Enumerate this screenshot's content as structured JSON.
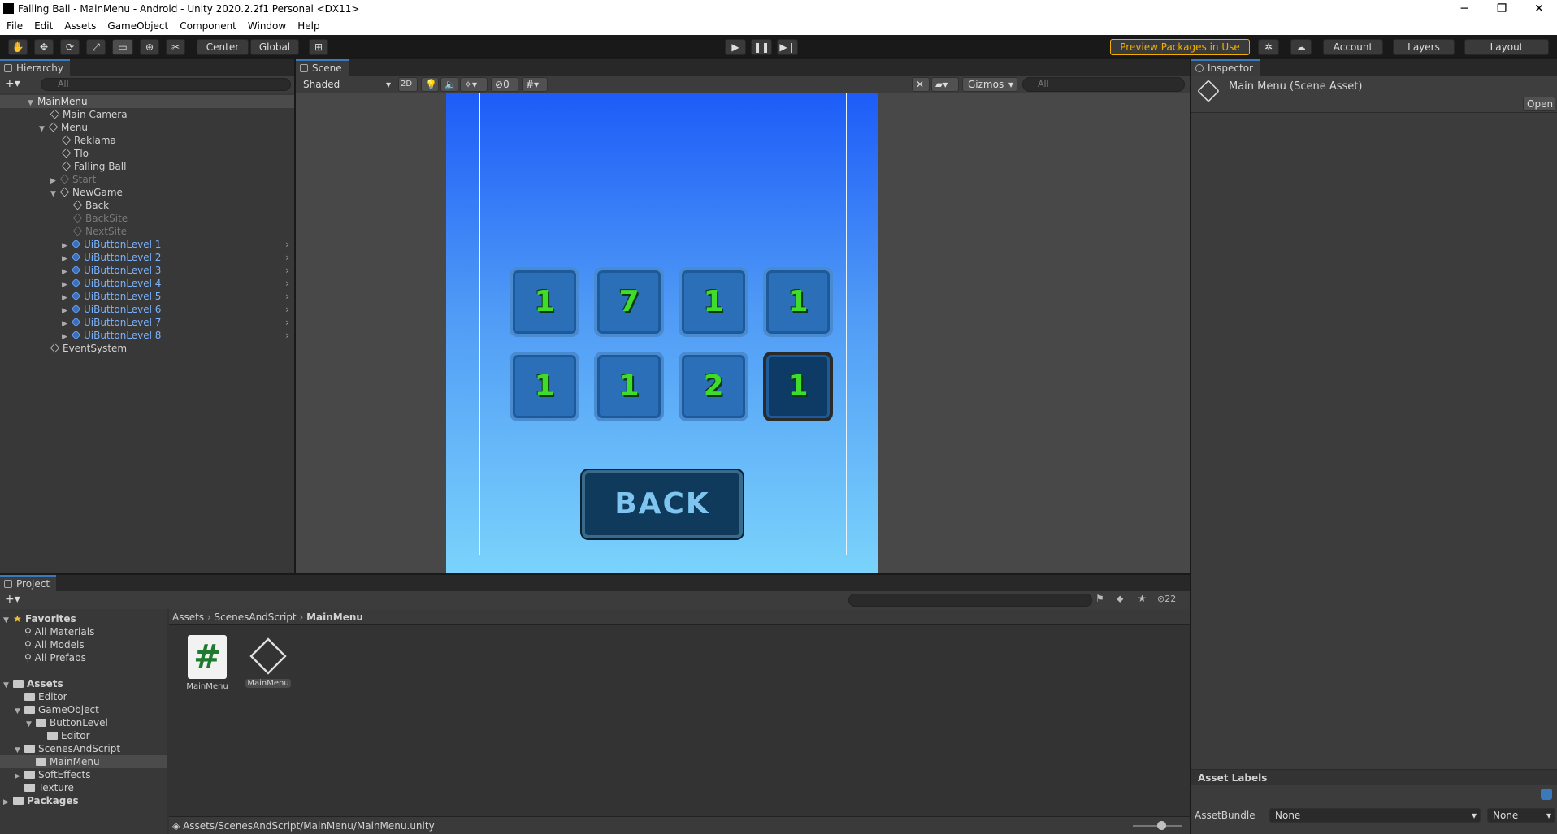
{
  "window": {
    "title": "Falling Ball - MainMenu - Android - Unity 2020.2.2f1 Personal <DX11>"
  },
  "menu": [
    "File",
    "Edit",
    "Assets",
    "GameObject",
    "Component",
    "Window",
    "Help"
  ],
  "toolbar": {
    "pivot": "Center",
    "space": "Global",
    "preview_packages": "Preview Packages in Use",
    "account": "Account",
    "layers": "Layers",
    "layout": "Layout"
  },
  "hierarchy": {
    "tab": "Hierarchy",
    "search_placeholder": "All",
    "items": [
      {
        "label": "MainMenu"
      },
      {
        "label": "Main Camera"
      },
      {
        "label": "Menu"
      },
      {
        "label": "Reklama"
      },
      {
        "label": "Tlo"
      },
      {
        "label": "Falling Ball"
      },
      {
        "label": "Start"
      },
      {
        "label": "NewGame"
      },
      {
        "label": "Back"
      },
      {
        "label": "BackSite"
      },
      {
        "label": "NextSite"
      },
      {
        "label": "UiButtonLevel 1"
      },
      {
        "label": "UiButtonLevel 2"
      },
      {
        "label": "UiButtonLevel 3"
      },
      {
        "label": "UiButtonLevel 4"
      },
      {
        "label": "UiButtonLevel 5"
      },
      {
        "label": "UiButtonLevel 6"
      },
      {
        "label": "UiButtonLevel 7"
      },
      {
        "label": "UiButtonLevel 8"
      },
      {
        "label": "EventSystem"
      }
    ]
  },
  "scene": {
    "tab": "Scene",
    "shading": "Shaded",
    "mode_2d": "2D",
    "hidden_count": "0",
    "gizmos": "Gizmos",
    "search_placeholder": "All",
    "levels": [
      "1",
      "7",
      "1",
      "1",
      "1",
      "1",
      "2",
      "1"
    ],
    "back_label": "BACK"
  },
  "inspector": {
    "tab": "Inspector",
    "asset_title": "Main Menu (Scene Asset)",
    "open": "Open",
    "asset_labels": "Asset Labels",
    "assetbundle_label": "AssetBundle",
    "assetbundle_value": "None",
    "variant_value": "None"
  },
  "project": {
    "tab": "Project",
    "hidden_count": "22",
    "favorites": {
      "label": "Favorites",
      "items": [
        "All Materials",
        "All Models",
        "All Prefabs"
      ]
    },
    "assets_label": "Assets",
    "tree": [
      "Editor",
      "GameObject",
      "ButtonLevel",
      "Editor",
      "ScenesAndScript",
      "MainMenu",
      "SoftEffects",
      "Texture"
    ],
    "packages_label": "Packages",
    "breadcrumb": [
      "Assets",
      "ScenesAndScript",
      "MainMenu"
    ],
    "files": [
      {
        "name": "MainMenu",
        "kind": "script"
      },
      {
        "name": "MainMenu",
        "kind": "scene"
      }
    ],
    "status_path": "Assets/ScenesAndScript/MainMenu/MainMenu.unity"
  }
}
